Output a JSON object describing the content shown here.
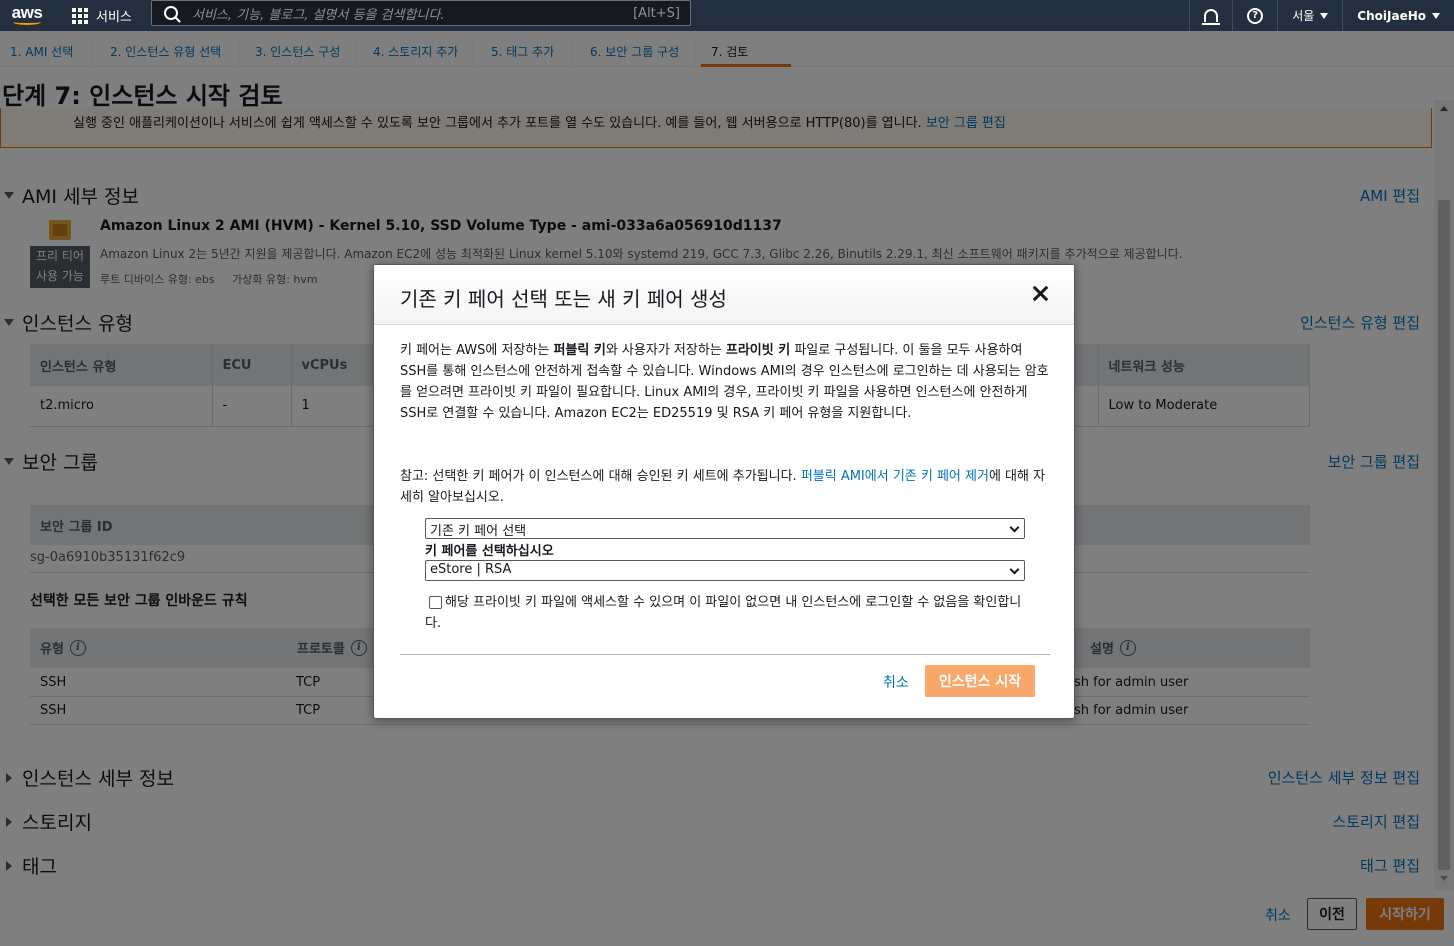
{
  "topbar": {
    "logo": "aws",
    "services_label": "서비스",
    "search_placeholder": "서비스, 기능, 블로그, 설명서 등을 검색합니다.",
    "search_shortcut": "[Alt+S]",
    "region": "서울",
    "user": "ChoiJaeHo",
    "icons": [
      "grid-icon",
      "search-icon",
      "bell-icon",
      "help-icon"
    ]
  },
  "steps": [
    "1. AMI 선택",
    "2. 인스턴스 유형 선택",
    "3. 인스턴스 구성",
    "4. 스토리지 추가",
    "5. 태그 추가",
    "6. 보안 그룹 구성",
    "7. 검토"
  ],
  "page_title": "단계 7: 인스턴스 시작 검토",
  "banner": {
    "text": "실행 중인 애플리케이션이나 서비스에 쉽게 액세스할 수 있도록 보안 그룹에서 추가 포트를 열 수도 있습니다. 예를 들어, 웹 서버용으로 HTTP(80)를 엽니다.",
    "link": "보안 그룹 편집"
  },
  "ami": {
    "heading": "AMI 세부 정보",
    "edit": "AMI 편집",
    "free_tier_line1": "프리 티어",
    "free_tier_line2": "사용 가능",
    "title": "Amazon Linux 2 AMI (HVM) - Kernel 5.10, SSD Volume Type - ami-033a6a056910d1137",
    "desc": "Amazon Linux 2는 5년간 지원을 제공합니다. Amazon EC2에 성능 최적화된 Linux kernel 5.10와 systemd 219, GCC 7.3, Glibc 2.26, Binutils 2.29.1, 최신 소프트웨어 패키지를 추가적으로 제공합니다.",
    "meta": "루트 디바이스 유형: ebs     가상화 유형: hvm"
  },
  "instance_type": {
    "heading": "인스턴스 유형",
    "edit": "인스턴스 유형 편집",
    "headers": [
      "인스턴스 유형",
      "ECU",
      "vCPUs",
      "네트워크 성능"
    ],
    "row": [
      "t2.micro",
      "-",
      "1",
      "Low to Moderate"
    ]
  },
  "security_group": {
    "heading": "보안 그룹",
    "edit": "보안 그룹 편집",
    "id_header": "보안 그룹 ID",
    "id_value": "sg-0a6910b35131f62c9",
    "rules_title": "선택한 모든 보안 그룹 인바운드 규칙",
    "rule_headers": [
      "유형",
      "프로토콜",
      "설명"
    ],
    "rules": [
      {
        "type": "SSH",
        "protocol": "TCP",
        "desc": "sh for admin user"
      },
      {
        "type": "SSH",
        "protocol": "TCP",
        "desc": "sh for admin user"
      }
    ]
  },
  "collapsed_sections": [
    {
      "heading": "인스턴스 세부 정보",
      "edit": "인스턴스 세부 정보 편집"
    },
    {
      "heading": "스토리지",
      "edit": "스토리지 편집"
    },
    {
      "heading": "태그",
      "edit": "태그 편집"
    }
  ],
  "footer": {
    "cancel": "취소",
    "previous": "이전",
    "launch": "시작하기"
  },
  "modal": {
    "title": "기존 키 페어 선택 또는 새 키 페어 생성",
    "p1_a": "키 페어는 AWS에 저장하는 ",
    "p1_b": "퍼블릭 키",
    "p1_c": "와 사용자가 저장하는 ",
    "p1_d": "프라이빗 키",
    "p1_e": " 파일로 구성됩니다. 이 둘을 모두 사용하여 SSH를 통해 인스턴스에 안전하게 접속할 수 있습니다. Windows AMI의 경우 인스턴스에 로그인하는 데 사용되는 암호를 얻으려면 프라이빗 키 파일이 필요합니다. Linux AMI의 경우, 프라이빗 키 파일을 사용하면 인스턴스에 안전하게 SSH로 연결할 수 있습니다. Amazon EC2는 ED25519 및 RSA 키 페어 유형을 지원합니다.",
    "note_a": "참고: 선택한 키 페어가 이 인스턴스에 대해 승인된 키 세트에 추가됩니다. ",
    "note_link": "퍼블릭 AMI에서 기존 키 페어 제거",
    "note_b": "에 대해 자세히 알아보십시오.",
    "select_action": "기존 키 페어 선택",
    "select_label": "키 페어를 선택하십시오",
    "select_keypair": "eStore | RSA",
    "ack": "해당 프라이빗 키 파일에 액세스할 수 있으며 이 파일이 없으면 내 인스턴스에 로그인할 수 없음을 확인합니다.",
    "cancel": "취소",
    "launch": "인스턴스 시작"
  }
}
